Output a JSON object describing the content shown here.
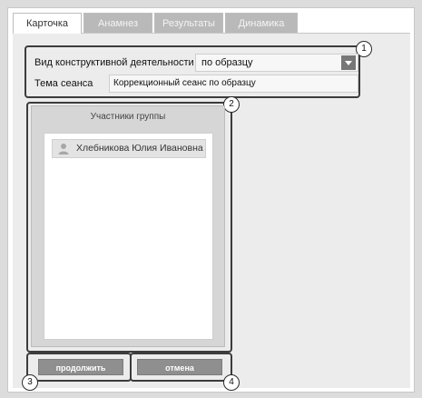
{
  "tabs": [
    {
      "label": "Карточка",
      "active": true
    },
    {
      "label": "Анамнез",
      "active": false
    },
    {
      "label": "Результаты",
      "active": false
    },
    {
      "label": "Динамика",
      "active": false
    }
  ],
  "form": {
    "activity_label": "Вид конструктивной деятельности",
    "activity_value": "по образцу",
    "topic_label": "Тема сеанса",
    "topic_value": "Коррекционный сеанс по образцу"
  },
  "participants": {
    "title": "Участники группы",
    "members": [
      "Хлебникова Юлия Ивановна"
    ]
  },
  "buttons": {
    "continue_label": "продолжить",
    "cancel_label": "отмена"
  },
  "callouts": [
    "1",
    "2",
    "3",
    "4"
  ],
  "icons": {
    "dropdown": "chevron-down-icon",
    "member": "person-icon"
  }
}
